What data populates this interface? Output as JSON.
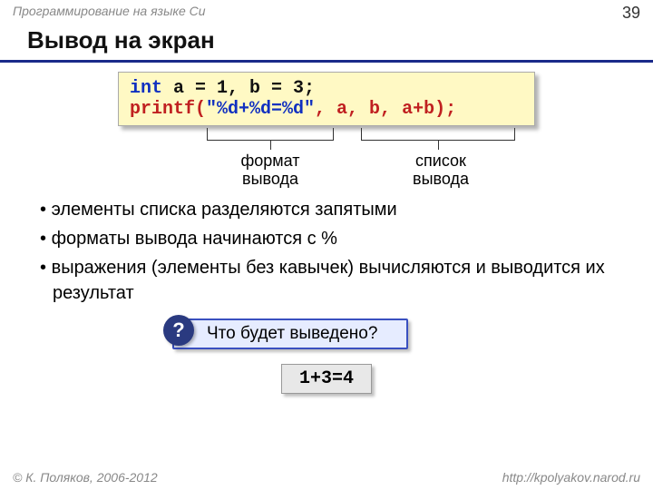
{
  "header": {
    "course": "Программирование на языке Си",
    "page": "39"
  },
  "title": "Вывод на экран",
  "code": {
    "line1_kw": "int",
    "line1_rest": " a = 1, b = 3;",
    "line2_fn": "printf(",
    "line2_fmt": "\"%d+%d=%d\"",
    "line2_args": ", a, b, a+b);"
  },
  "annotations": {
    "format_label": "формат\nвывода",
    "list_label": "список\nвывода"
  },
  "bullets": [
    "элементы списка разделяются запятыми",
    "форматы вывода начинаются с %",
    "выражения (элементы без кавычек) вычисляются и выводится их результат"
  ],
  "question": {
    "mark": "?",
    "text": "Что будет выведено?"
  },
  "result": "1+3=4",
  "footer": {
    "copyright": "© К. Поляков, 2006-2012",
    "url": "http://kpolyakov.narod.ru"
  }
}
